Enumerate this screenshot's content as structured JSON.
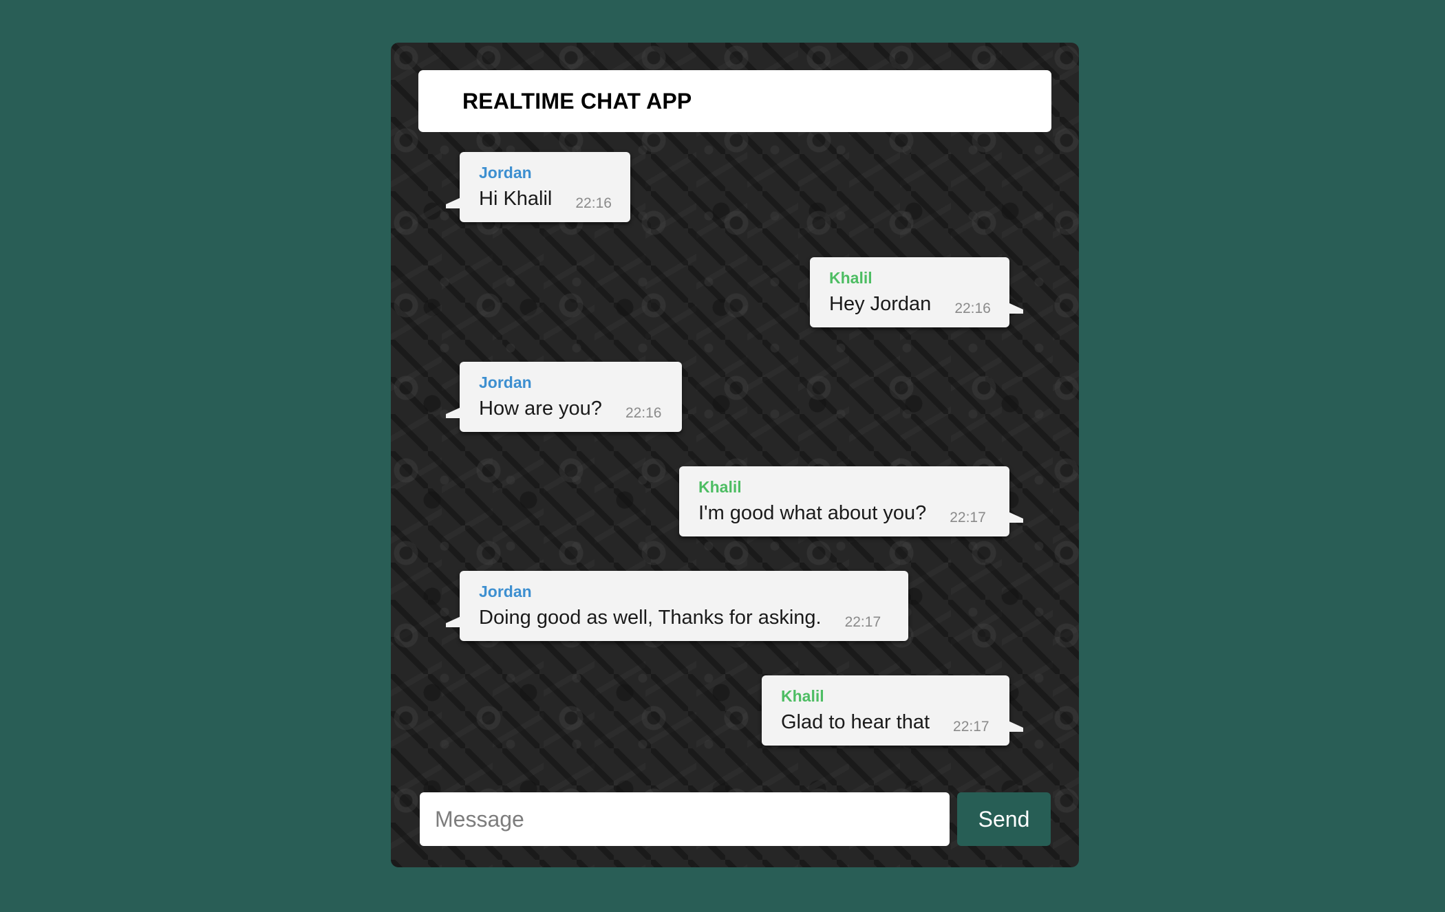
{
  "app": {
    "title": "REALTIME CHAT APP"
  },
  "messages": [
    {
      "sender": "Jordan",
      "text": "Hi Khalil",
      "time": "22:16",
      "side": "left"
    },
    {
      "sender": "Khalil",
      "text": "Hey Jordan",
      "time": "22:16",
      "side": "right"
    },
    {
      "sender": "Jordan",
      "text": "How are you?",
      "time": "22:16",
      "side": "left"
    },
    {
      "sender": "Khalil",
      "text": "I'm good what about you?",
      "time": "22:17",
      "side": "right"
    },
    {
      "sender": "Jordan",
      "text": "Doing good as well, Thanks for asking.",
      "time": "22:17",
      "side": "left"
    },
    {
      "sender": "Khalil",
      "text": "Glad to hear that",
      "time": "22:17",
      "side": "right"
    }
  ],
  "composer": {
    "placeholder": "Message",
    "value": "",
    "send_label": "Send"
  },
  "colors": {
    "page_background": "#295e56",
    "chat_background": "#262626",
    "jordan_name": "#3d8fd0",
    "khalil_name": "#4dbd63",
    "bubble": "#f3f3f3",
    "send_button": "#275e55"
  }
}
